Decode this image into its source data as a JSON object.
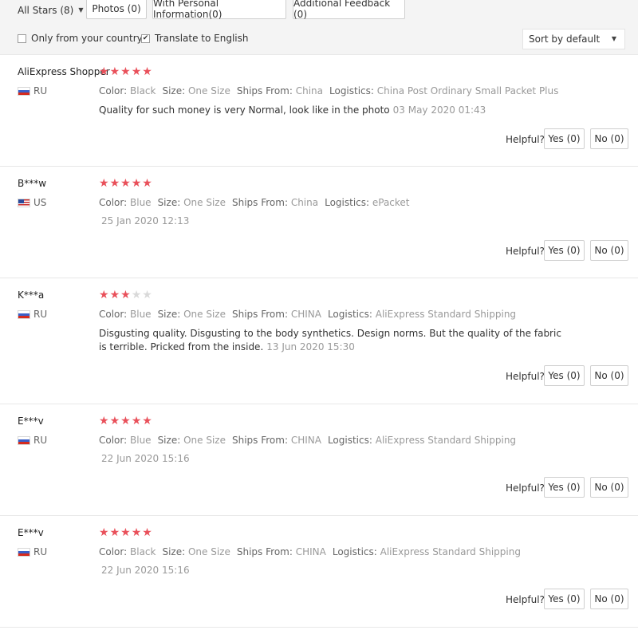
{
  "filters": {
    "all_stars": "All Stars (8)",
    "tabs": [
      "Photos (0)",
      "With Personal Information(0)",
      "Additional Feedback (0)"
    ],
    "only_country": "Only from your country",
    "only_country_checked": false,
    "translate": "Translate to English",
    "translate_checked": true,
    "sort": "Sort by default"
  },
  "labels": {
    "color": "Color:",
    "size": "Size:",
    "ships_from": "Ships From:",
    "logistics": "Logistics:",
    "helpful": "Helpful?",
    "yes": "Yes (0)",
    "no": "No (0)"
  },
  "reviews": [
    {
      "user": "AliExpress Shopper",
      "country": "RU",
      "rating": 5,
      "color": "Black",
      "size": "One Size",
      "ships_from": "China",
      "logistics": "China Post Ordinary Small Packet Plus",
      "text": "Quality for such money is very Normal, look like in the photo",
      "date": "03 May 2020 01:43"
    },
    {
      "user": "B***w",
      "country": "US",
      "rating": 5,
      "color": "Blue",
      "size": "One Size",
      "ships_from": "China",
      "logistics": "ePacket",
      "text": "",
      "date": "25 Jan 2020 12:13"
    },
    {
      "user": "K***a",
      "country": "RU",
      "rating": 3,
      "color": "Blue",
      "size": "One Size",
      "ships_from": "CHINA",
      "logistics": "AliExpress Standard Shipping",
      "text": "Disgusting quality. Disgusting to the body synthetics. Design norms. But the quality of the fabric is terrible. Pricked from the inside.",
      "date": "13 Jun 2020 15:30"
    },
    {
      "user": "E***v",
      "country": "RU",
      "rating": 5,
      "color": "Blue",
      "size": "One Size",
      "ships_from": "CHINA",
      "logistics": "AliExpress Standard Shipping",
      "text": "",
      "date": "22 Jun 2020 15:16"
    },
    {
      "user": "E***v",
      "country": "RU",
      "rating": 5,
      "color": "Black",
      "size": "One Size",
      "ships_from": "CHINA",
      "logistics": "AliExpress Standard Shipping",
      "text": "",
      "date": "22 Jun 2020 15:16"
    }
  ],
  "colors": {
    "star_on": "#e9505a",
    "star_off": "#d9d9d9"
  }
}
